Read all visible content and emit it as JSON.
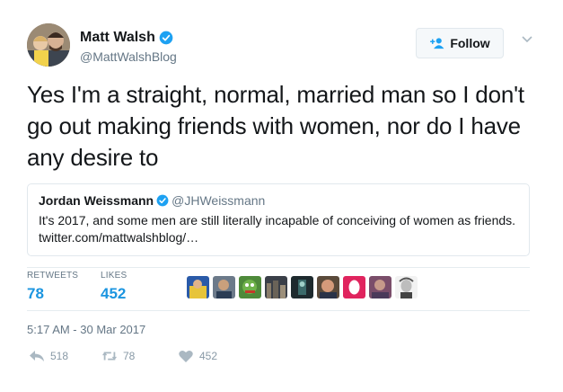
{
  "author": {
    "name": "Matt Walsh",
    "handle": "@MattWalshBlog",
    "verified_icon": "verified-badge-icon",
    "follow_label": "Follow",
    "follow_icon": "add-user-icon",
    "menu_icon": "chevron-down-icon"
  },
  "tweet": {
    "text": "Yes I'm a straight, normal, married man so I don't go out making friends with women, nor do I have any desire to"
  },
  "quote": {
    "name": "Jordan Weissmann",
    "handle": "@JHWeissmann",
    "text": "It's 2017, and some men are still literally incapable of conceiving of women as friends. twitter.com/mattwalshblog/…"
  },
  "stats": {
    "retweets_label": "RETWEETS",
    "retweets_value": "78",
    "likes_label": "LIKES",
    "likes_value": "452"
  },
  "timestamp": "5:17 AM - 30 Mar 2017",
  "actions": {
    "reply_count": "518",
    "retweet_count": "78",
    "like_count": "452"
  },
  "colors": {
    "accent": "#1b95e0",
    "verified": "#1da1f2",
    "muted": "#657786"
  }
}
